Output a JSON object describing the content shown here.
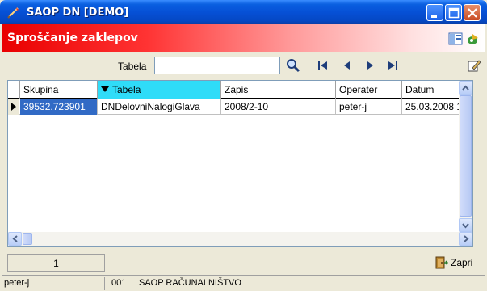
{
  "window": {
    "title": "SAOP DN [DEMO]"
  },
  "header": {
    "title": "Sproščanje zaklepov"
  },
  "toolbar": {
    "filter_label": "Tabela",
    "filter_value": "",
    "filter_placeholder": ""
  },
  "grid": {
    "columns": [
      "Skupina",
      "Tabela",
      "Zapis",
      "Operater",
      "Datum"
    ],
    "sorted_column": "Tabela",
    "rows": [
      {
        "skupina": "39532.723901",
        "tabela": "DNDelovniNalogiGlava",
        "zapis": "2008/2-10",
        "operater": "peter-j",
        "datum": "25.03.2008 17:"
      }
    ]
  },
  "footer": {
    "page": "1",
    "close_label": "Zapri"
  },
  "status": {
    "user": "peter-j",
    "code": "001",
    "company": "SAOP RAČUNALNIŠTVO"
  },
  "colors": {
    "titlebar": "#0650d6",
    "header_red": "#e90000",
    "sorted_header": "#2fdcf8",
    "selection": "#316ac5"
  }
}
